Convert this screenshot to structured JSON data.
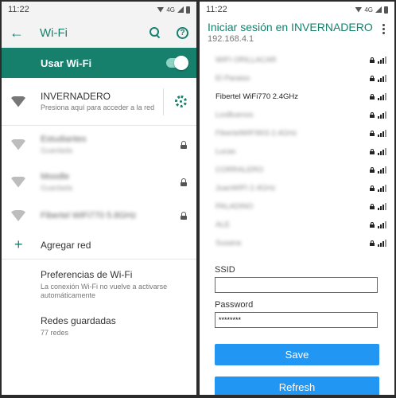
{
  "left": {
    "status": {
      "time": "11:22",
      "network": "4G"
    },
    "appbar": {
      "title": "Wi-Fi"
    },
    "toggle": {
      "label": "Usar Wi-Fi",
      "enabled": true
    },
    "connected": {
      "name": "INVERNADERO",
      "subtitle": "Presiona aquí para acceder a la red"
    },
    "networks": [
      {
        "name": "Estudiantes",
        "sub": "Guardada"
      },
      {
        "name": "Moodle",
        "sub": "Guardada"
      },
      {
        "name": "Fibertel WiFi770 5.8GHz"
      }
    ],
    "add_network": {
      "label": "Agregar red"
    },
    "preferences": {
      "title": "Preferencias de Wi-Fi",
      "subtitle": "La conexión Wi-Fi no vuelve a activarse automáticamente"
    },
    "saved": {
      "title": "Redes guardadas",
      "subtitle": "77 redes"
    }
  },
  "right": {
    "status": {
      "time": "11:22",
      "network": "4G"
    },
    "portal": {
      "title": "Iniciar sesión en INVERNADERO",
      "ip": "192.168.4.1"
    },
    "scan_list": [
      {
        "name": "WIFI ORILLACAR"
      },
      {
        "name": "El Paraiso"
      },
      {
        "name": "Fibertel WiFi770 2.4GHz"
      },
      {
        "name": "LosBuenos"
      },
      {
        "name": "FibertelWIFI903 2.4GHz"
      },
      {
        "name": "Lucas"
      },
      {
        "name": "CORRALERO"
      },
      {
        "name": "JuanWIFI 2.4GHz"
      },
      {
        "name": "PALADINO"
      },
      {
        "name": "ALE"
      },
      {
        "name": "Susana"
      }
    ],
    "form": {
      "ssid_label": "SSID",
      "ssid_value": "",
      "password_label": "Password",
      "password_value": "********"
    },
    "buttons": {
      "save": "Save",
      "refresh": "Refresh"
    }
  },
  "colors": {
    "accent": "#17806d",
    "button": "#2196f3"
  }
}
